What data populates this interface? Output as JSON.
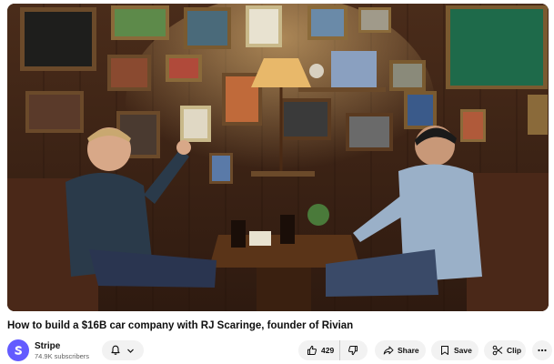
{
  "video": {
    "title": "How to build a $16B car company with RJ Scaringe, founder of Rivian"
  },
  "channel": {
    "name": "Stripe",
    "subscribers": "74.9K subscribers"
  },
  "actions": {
    "like_count": "429",
    "share_label": "Share",
    "save_label": "Save",
    "clip_label": "Clip"
  },
  "icons": {
    "bell": "bell-icon",
    "chevron": "chevron-down-icon",
    "like": "thumbs-up-icon",
    "dislike": "thumbs-down-icon",
    "share": "share-arrow-icon",
    "save": "playlist-add-icon",
    "clip": "scissors-icon",
    "more": "more-horizontal-icon"
  },
  "colors": {
    "brand_avatar": "#635bff",
    "pill_bg": "#f2f2f2"
  }
}
